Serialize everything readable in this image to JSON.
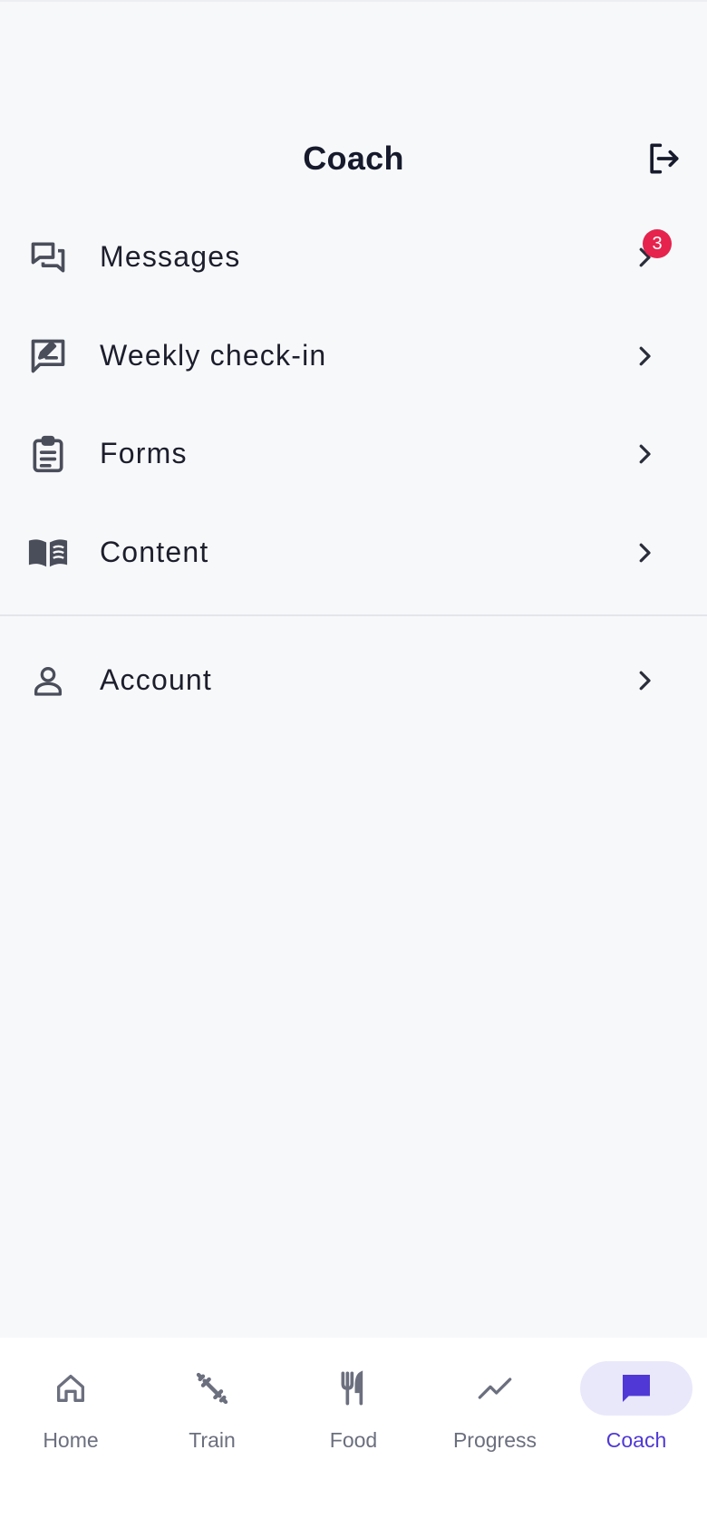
{
  "header": {
    "title": "Coach",
    "logout_icon": "logout-icon"
  },
  "menu": {
    "items": [
      {
        "label": "Messages",
        "icon": "chat-bubbles-icon",
        "badge": "3"
      },
      {
        "label": "Weekly check-in",
        "icon": "edit-note-icon"
      },
      {
        "label": "Forms",
        "icon": "clipboard-icon"
      },
      {
        "label": "Content",
        "icon": "open-book-icon"
      }
    ],
    "secondary": [
      {
        "label": "Account",
        "icon": "person-icon"
      }
    ]
  },
  "bottom_nav": {
    "items": [
      {
        "label": "Home",
        "icon": "home-icon",
        "active": false
      },
      {
        "label": "Train",
        "icon": "dumbbell-icon",
        "active": false
      },
      {
        "label": "Food",
        "icon": "fork-knife-icon",
        "active": false
      },
      {
        "label": "Progress",
        "icon": "trend-line-icon",
        "active": false
      },
      {
        "label": "Coach",
        "icon": "chat-icon",
        "active": true
      }
    ]
  },
  "colors": {
    "background": "#f7f8fa",
    "accent": "#4f38d6",
    "accent_bg": "#e9e8fb",
    "badge": "#e5234d",
    "icon": "#4a4d5a",
    "nav_inactive": "#6b6f7e"
  }
}
